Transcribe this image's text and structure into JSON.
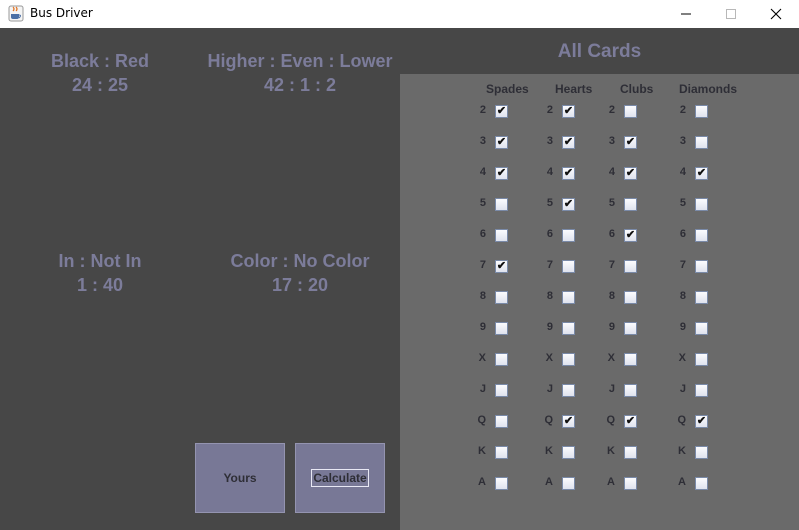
{
  "window": {
    "title": "Bus Driver",
    "icon": "java-coffee-icon",
    "minimize": "—",
    "maximize": "☐",
    "close": "✕"
  },
  "stats": {
    "black_red": {
      "label": "Black : Red",
      "value": "24 : 25"
    },
    "higher_even_lower": {
      "label": "Higher : Even : Lower",
      "value": "42 : 1 : 2"
    },
    "in_not_in": {
      "label": "In : Not In",
      "value": "1 : 40"
    },
    "color_no_color": {
      "label": "Color : No Color",
      "value": "17 : 20"
    }
  },
  "buttons": {
    "yours": "Yours",
    "calculate": "Calculate"
  },
  "cards": {
    "title": "All Cards",
    "check_mark": "✔",
    "suits": [
      {
        "id": "spades",
        "name": "Spades"
      },
      {
        "id": "hearts",
        "name": "Hearts"
      },
      {
        "id": "clubs",
        "name": "Clubs"
      },
      {
        "id": "diamonds",
        "name": "Diamonds"
      }
    ],
    "ranks": [
      "2",
      "3",
      "4",
      "5",
      "6",
      "7",
      "8",
      "9",
      "X",
      "J",
      "Q",
      "K",
      "A"
    ],
    "checked": {
      "spades": [
        true,
        true,
        true,
        false,
        false,
        true,
        false,
        false,
        false,
        false,
        false,
        false,
        false
      ],
      "hearts": [
        true,
        true,
        true,
        true,
        false,
        false,
        false,
        false,
        false,
        false,
        true,
        false,
        false
      ],
      "clubs": [
        false,
        true,
        true,
        false,
        true,
        false,
        false,
        false,
        false,
        false,
        true,
        false,
        false
      ],
      "diamonds": [
        false,
        false,
        true,
        false,
        false,
        false,
        false,
        false,
        false,
        false,
        true,
        false,
        false
      ]
    }
  }
}
